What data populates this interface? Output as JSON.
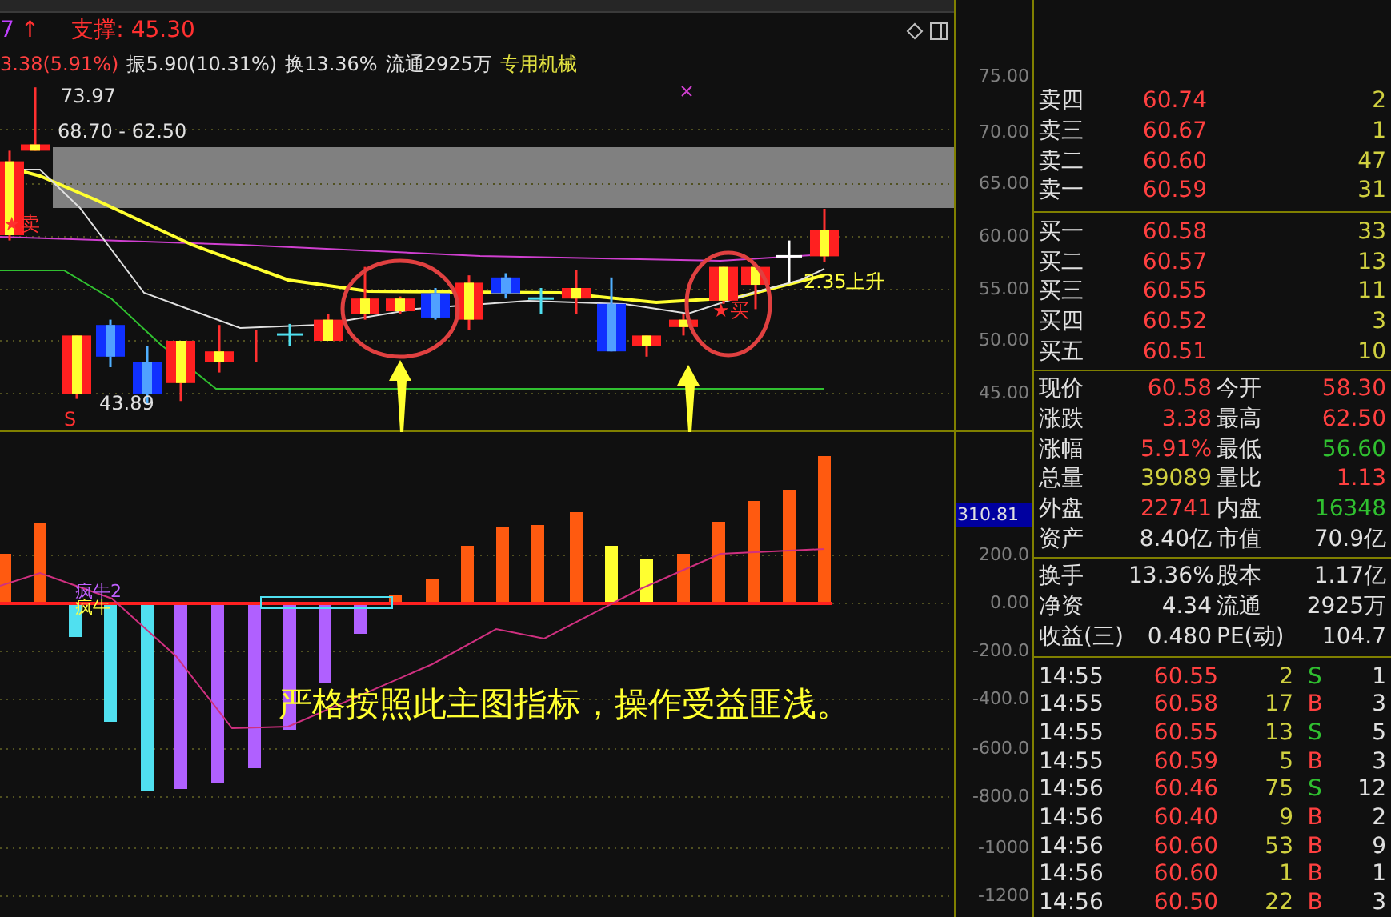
{
  "header": {
    "code_fragment": "7",
    "arrow": "↑",
    "support": "支撑: 45.30",
    "quote_line": [
      {
        "text": "3.38(5.91%)",
        "kind": "change"
      },
      {
        "text": "振5.90(10.31%)",
        "kind": "plain"
      },
      {
        "text": "换13.36%",
        "kind": "plain"
      },
      {
        "text": "流通2925万",
        "kind": "plain"
      },
      {
        "text": "专用机械",
        "kind": "sector"
      }
    ]
  },
  "main_chart": {
    "labels": [
      {
        "text": "73.97",
        "kind": "price"
      },
      {
        "text": "68.70 - 62.50",
        "kind": "price"
      },
      {
        "text": "★卖",
        "kind": "signal"
      },
      {
        "text": "43.89",
        "kind": "price"
      },
      {
        "text": "S",
        "kind": "signal"
      },
      {
        "text": "★买",
        "kind": "signal"
      },
      {
        "text": "2.35上升",
        "kind": "note"
      }
    ]
  },
  "price_axis": [
    "75.00",
    "70.00",
    "65.00",
    "60.00",
    "55.00",
    "50.00",
    "45.00"
  ],
  "indicator": {
    "labels": [
      {
        "text": "疯牛2",
        "kind": "purple"
      },
      {
        "text": "疯牛",
        "kind": "yellow"
      }
    ],
    "caption": "严格按照此主图指标，操作受益匪浅。",
    "current_value": "310.81",
    "axis": [
      "200.0",
      "0.00",
      "-200.0",
      "-400.0",
      "-600.0",
      "-800.0",
      "-1000",
      "-1200"
    ]
  },
  "order_book": {
    "asks": [
      {
        "label": "卖四",
        "price": "60.74",
        "volume": "2"
      },
      {
        "label": "卖三",
        "price": "60.67",
        "volume": "1"
      },
      {
        "label": "卖二",
        "price": "60.60",
        "volume": "47"
      },
      {
        "label": "卖一",
        "price": "60.59",
        "volume": "31"
      }
    ],
    "bids": [
      {
        "label": "买一",
        "price": "60.58",
        "volume": "33"
      },
      {
        "label": "买二",
        "price": "60.57",
        "volume": "13"
      },
      {
        "label": "买三",
        "price": "60.55",
        "volume": "11"
      },
      {
        "label": "买四",
        "price": "60.52",
        "volume": "3"
      },
      {
        "label": "买五",
        "price": "60.51",
        "volume": "10"
      }
    ]
  },
  "quote": [
    {
      "left": {
        "label": "现价",
        "value": "60.58",
        "kind": "up"
      },
      "right": {
        "label": "今开",
        "value": "58.30",
        "kind": "up"
      }
    },
    {
      "left": {
        "label": "涨跌",
        "value": "3.38",
        "kind": "up"
      },
      "right": {
        "label": "最高",
        "value": "62.50",
        "kind": "up"
      }
    },
    {
      "left": {
        "label": "涨幅",
        "value": "5.91%",
        "kind": "up"
      },
      "right": {
        "label": "最低",
        "value": "56.60",
        "kind": "down"
      }
    },
    {
      "left": {
        "label": "总量",
        "value": "39089",
        "kind": "volume"
      },
      "right": {
        "label": "量比",
        "value": "1.13",
        "kind": "up"
      }
    },
    {
      "left": {
        "label": "外盘",
        "value": "22741",
        "kind": "up"
      },
      "right": {
        "label": "内盘",
        "value": "16348",
        "kind": "down"
      }
    },
    {
      "left": {
        "label": "资产",
        "value": "8.40亿",
        "kind": "plain"
      },
      "right": {
        "label": "市值",
        "value": "70.9亿",
        "kind": "plain"
      }
    }
  ],
  "stats": [
    {
      "label": "换手",
      "value": "13.36%",
      "label2": "股本",
      "value2": "1.17亿"
    },
    {
      "label": "净资",
      "value": "4.34",
      "label2": "流通",
      "value2": "2925万"
    },
    {
      "label": "收益(三)",
      "value": "0.480",
      "label2": "PE(动)",
      "value2": "104.7"
    }
  ],
  "trades": [
    {
      "time": "14:55",
      "price": "60.55",
      "volume": "2",
      "side": "S",
      "kind": "sell",
      "count": "1"
    },
    {
      "time": "14:55",
      "price": "60.58",
      "volume": "17",
      "side": "B",
      "kind": "buy",
      "count": "3"
    },
    {
      "time": "14:55",
      "price": "60.55",
      "volume": "13",
      "side": "S",
      "kind": "sell",
      "count": "5"
    },
    {
      "time": "14:55",
      "price": "60.59",
      "volume": "5",
      "side": "B",
      "kind": "buy",
      "count": "3"
    },
    {
      "time": "14:56",
      "price": "60.46",
      "volume": "75",
      "side": "S",
      "kind": "sell",
      "count": "12"
    },
    {
      "time": "14:56",
      "price": "60.40",
      "volume": "9",
      "side": "B",
      "kind": "buy",
      "count": "2"
    },
    {
      "time": "14:56",
      "price": "60.60",
      "volume": "53",
      "side": "B",
      "kind": "buy",
      "count": "9"
    },
    {
      "time": "14:56",
      "price": "60.60",
      "volume": "1",
      "side": "B",
      "kind": "buy",
      "count": "1"
    },
    {
      "time": "14:56",
      "price": "60.50",
      "volume": "22",
      "side": "B",
      "kind": "buy",
      "count": "3"
    }
  ]
}
